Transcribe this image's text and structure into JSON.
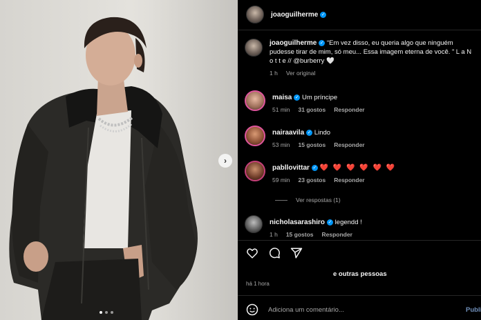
{
  "post": {
    "author": "joaoguilherme",
    "caption": "“Em vez disso, eu queria algo que ninguém pudesse tirar de mim, só meu... Essa imagem eterna de você. ” L a N o t t e // @burberry 🤍",
    "caption_time": "1 h",
    "see_translation": "Ver original",
    "likes_text": "e outras pessoas",
    "posted_ago": "há 1 hora"
  },
  "comments": [
    {
      "user": "maisa",
      "text": "Um príncipe",
      "time": "51 min",
      "likes": "31 gostos",
      "reply": "Responder"
    },
    {
      "user": "nairaavila",
      "text": "Lindo",
      "time": "53 min",
      "likes": "15 gostos",
      "reply": "Responder"
    },
    {
      "user": "pabllovittar",
      "text": "❤️ ❤️ ❤️ ❤️ ❤️ ❤️",
      "time": "59 min",
      "likes": "23 gostos",
      "reply": "Responder",
      "view_replies": "Ver respostas (1)"
    },
    {
      "user": "nicholasarashiro",
      "text": "legendd !",
      "time": "1 h",
      "likes": "15 gostos",
      "reply": "Responder"
    }
  ],
  "composer": {
    "placeholder": "Adiciona um comentário...",
    "publish": "Publi"
  },
  "carousel": {
    "count": 3,
    "active": 0,
    "next": "›"
  },
  "colors": {
    "verified": "#0095f6",
    "heart": "#ed4956",
    "background": "#000000"
  },
  "icons": [
    "verified-badge-icon",
    "heart-icon",
    "comment-icon",
    "share-icon",
    "emoji-icon",
    "chevron-right-icon"
  ]
}
